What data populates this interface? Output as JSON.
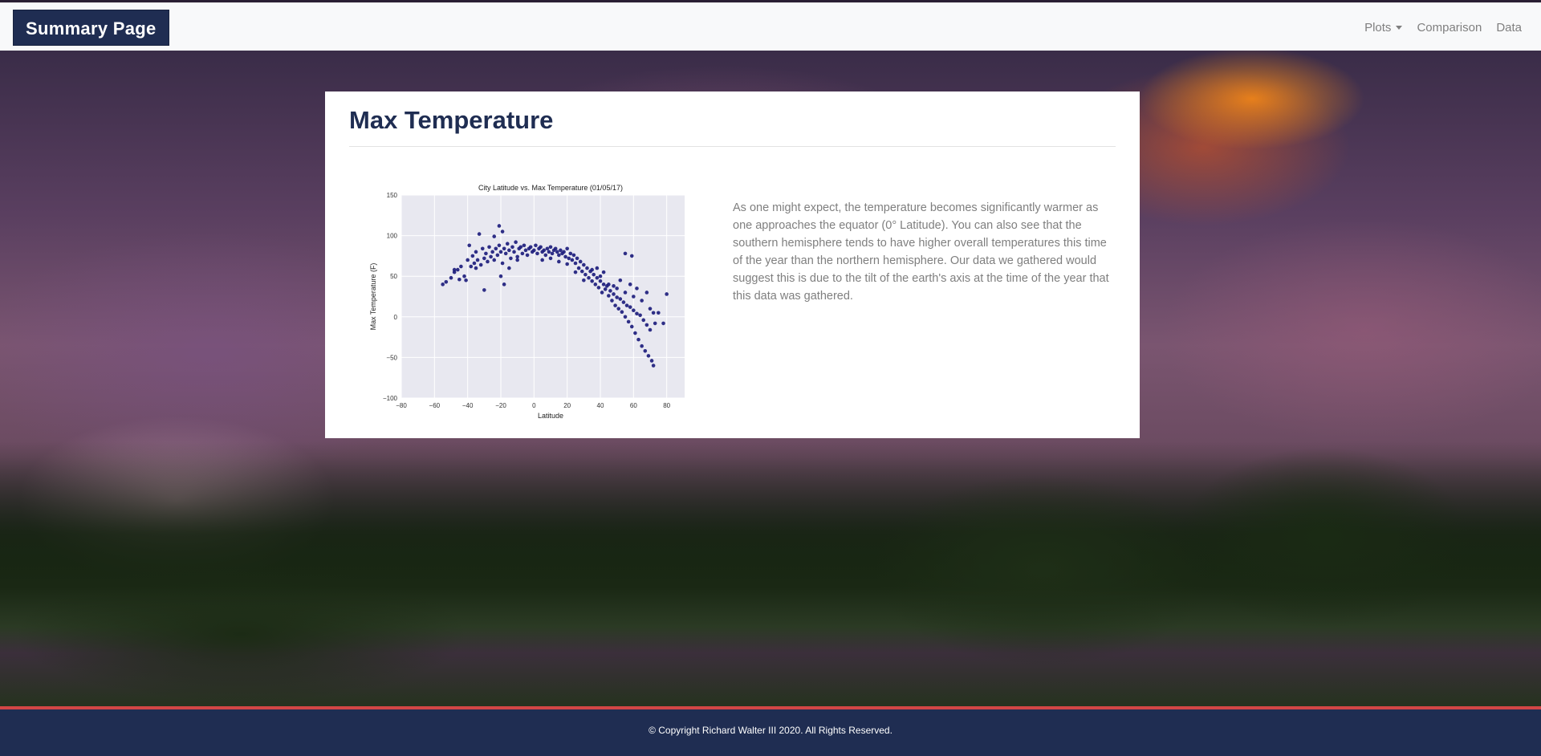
{
  "brand": "Summary Page",
  "nav": {
    "plots": "Plots",
    "comparison": "Comparison",
    "data": "Data"
  },
  "page": {
    "title": "Max Temperature",
    "description": "As one might expect, the temperature becomes significantly warmer as one approaches the equator (0° Latitude). You can also see that the southern hemisphere tends to have higher overall temperatures this time of the year than the northern hemisphere. Our data we gathered would suggest this is due to the tilt of the earth's axis at the time of the year that this data was gathered."
  },
  "footer": "© Copyright Richard Walter III 2020. All Rights Reserved.",
  "colors": {
    "brand": "#1f2d52",
    "points": "#1a1a7a",
    "plot_bg": "#e8e8f0",
    "footer_line": "#d24646"
  },
  "chart_data": {
    "type": "scatter",
    "title": "City Latitude vs. Max Temperature (01/05/17)",
    "xlabel": "Latitude",
    "ylabel": "Max Temperature (F)",
    "xlim": [
      -80,
      100
    ],
    "ylim": [
      -100,
      150
    ],
    "xticks": [
      -80,
      -60,
      -40,
      -20,
      0,
      20,
      40,
      60,
      80,
      100
    ],
    "yticks": [
      -100,
      -50,
      0,
      50,
      100,
      150
    ],
    "grid": true,
    "points": [
      [
        -55,
        40
      ],
      [
        -53,
        43
      ],
      [
        -50,
        48
      ],
      [
        -48,
        55
      ],
      [
        -46,
        58
      ],
      [
        -45,
        46
      ],
      [
        -44,
        62
      ],
      [
        -42,
        50
      ],
      [
        -40,
        70
      ],
      [
        -39,
        88
      ],
      [
        -38,
        62
      ],
      [
        -37,
        75
      ],
      [
        -36,
        66
      ],
      [
        -35,
        80
      ],
      [
        -34,
        70
      ],
      [
        -33,
        102
      ],
      [
        -32,
        64
      ],
      [
        -31,
        84
      ],
      [
        -30,
        33
      ],
      [
        -30,
        72
      ],
      [
        -29,
        78
      ],
      [
        -28,
        68
      ],
      [
        -27,
        86
      ],
      [
        -26,
        74
      ],
      [
        -25,
        80
      ],
      [
        -24,
        99
      ],
      [
        -24,
        70
      ],
      [
        -23,
        84
      ],
      [
        -22,
        76
      ],
      [
        -21,
        112
      ],
      [
        -21,
        88
      ],
      [
        -20,
        80
      ],
      [
        -19,
        66
      ],
      [
        -19,
        105
      ],
      [
        -18,
        84
      ],
      [
        -17,
        78
      ],
      [
        -16,
        90
      ],
      [
        -15,
        82
      ],
      [
        -14,
        72
      ],
      [
        -13,
        86
      ],
      [
        -12,
        80
      ],
      [
        -11,
        92
      ],
      [
        -10,
        74
      ],
      [
        -9,
        84
      ],
      [
        -8,
        86
      ],
      [
        -7,
        78
      ],
      [
        -6,
        88
      ],
      [
        -5,
        82
      ],
      [
        -4,
        76
      ],
      [
        -3,
        84
      ],
      [
        -2,
        86
      ],
      [
        -1,
        80
      ],
      [
        0,
        82
      ],
      [
        1,
        88
      ],
      [
        2,
        78
      ],
      [
        3,
        84
      ],
      [
        4,
        86
      ],
      [
        5,
        80
      ],
      [
        6,
        82
      ],
      [
        7,
        76
      ],
      [
        8,
        84
      ],
      [
        9,
        80
      ],
      [
        10,
        86
      ],
      [
        11,
        78
      ],
      [
        12,
        82
      ],
      [
        13,
        84
      ],
      [
        14,
        80
      ],
      [
        15,
        76
      ],
      [
        16,
        82
      ],
      [
        17,
        78
      ],
      [
        18,
        80
      ],
      [
        19,
        74
      ],
      [
        20,
        84
      ],
      [
        21,
        72
      ],
      [
        22,
        78
      ],
      [
        23,
        70
      ],
      [
        24,
        76
      ],
      [
        25,
        66
      ],
      [
        26,
        72
      ],
      [
        27,
        60
      ],
      [
        28,
        68
      ],
      [
        29,
        56
      ],
      [
        30,
        64
      ],
      [
        31,
        52
      ],
      [
        32,
        60
      ],
      [
        33,
        48
      ],
      [
        34,
        56
      ],
      [
        35,
        44
      ],
      [
        36,
        52
      ],
      [
        37,
        40
      ],
      [
        38,
        48
      ],
      [
        39,
        36
      ],
      [
        40,
        44
      ],
      [
        41,
        30
      ],
      [
        42,
        40
      ],
      [
        43,
        34
      ],
      [
        44,
        38
      ],
      [
        45,
        26
      ],
      [
        46,
        32
      ],
      [
        47,
        20
      ],
      [
        48,
        28
      ],
      [
        49,
        14
      ],
      [
        50,
        24
      ],
      [
        51,
        10
      ],
      [
        52,
        22
      ],
      [
        53,
        6
      ],
      [
        54,
        18
      ],
      [
        55,
        78
      ],
      [
        55,
        0
      ],
      [
        56,
        14
      ],
      [
        57,
        -6
      ],
      [
        58,
        12
      ],
      [
        59,
        75
      ],
      [
        59,
        -12
      ],
      [
        60,
        8
      ],
      [
        61,
        -20
      ],
      [
        62,
        4
      ],
      [
        63,
        -28
      ],
      [
        64,
        2
      ],
      [
        65,
        -36
      ],
      [
        66,
        -4
      ],
      [
        67,
        -42
      ],
      [
        68,
        -10
      ],
      [
        69,
        -48
      ],
      [
        70,
        -16
      ],
      [
        71,
        -54
      ],
      [
        72,
        -60
      ],
      [
        73,
        -8
      ],
      [
        75,
        5
      ],
      [
        78,
        -8
      ],
      [
        80,
        28
      ],
      [
        -48,
        58
      ],
      [
        -41,
        45
      ],
      [
        -35,
        60
      ],
      [
        -20,
        50
      ],
      [
        -18,
        40
      ],
      [
        -15,
        60
      ],
      [
        -10,
        70
      ],
      [
        5,
        70
      ],
      [
        10,
        72
      ],
      [
        15,
        68
      ],
      [
        20,
        65
      ],
      [
        25,
        55
      ],
      [
        30,
        45
      ],
      [
        35,
        58
      ],
      [
        40,
        50
      ],
      [
        45,
        40
      ],
      [
        50,
        35
      ],
      [
        55,
        30
      ],
      [
        60,
        25
      ],
      [
        65,
        20
      ],
      [
        70,
        10
      ],
      [
        72,
        5
      ],
      [
        68,
        30
      ],
      [
        62,
        35
      ],
      [
        58,
        40
      ],
      [
        52,
        45
      ],
      [
        48,
        38
      ],
      [
        42,
        55
      ],
      [
        38,
        60
      ]
    ]
  }
}
